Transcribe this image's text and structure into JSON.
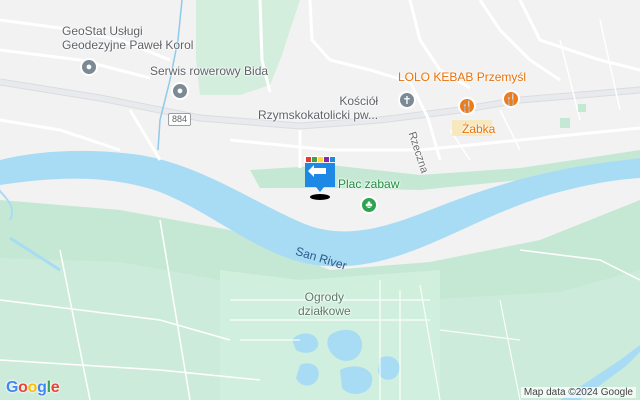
{
  "map": {
    "places": [
      {
        "id": "geostat",
        "text": "GeoStat Usługi\nGeodezyjne Paweł Korol",
        "kind": "business"
      },
      {
        "id": "bida",
        "text": "Serwis rowerowy Bida",
        "kind": "business"
      },
      {
        "id": "kosciol",
        "text": "Kościół\nRzymskokatolicki pw...",
        "kind": "church"
      },
      {
        "id": "lolo",
        "text": "LOLO KEBAB Przemyśl",
        "kind": "food"
      },
      {
        "id": "zabka",
        "text": "Żabka",
        "kind": "shop"
      },
      {
        "id": "plac",
        "text": "Plac zabaw",
        "kind": "park"
      },
      {
        "id": "ogrody",
        "text": "Ogrody\ndziałkowe",
        "kind": "area"
      }
    ],
    "road_labels": {
      "rzeczna": "Rzeczna",
      "route_shield": "884"
    },
    "water_label": "San River",
    "attribution": "Map data ©2024 Google",
    "logo": [
      "G",
      "o",
      "o",
      "g",
      "l",
      "e"
    ],
    "colors": {
      "water": "#a8dcf4",
      "park": "#c5e8d4",
      "land": "#f2f2f2",
      "road": "#ffffff",
      "highway": "#e8eaed",
      "accent_orange": "#e8710a",
      "poi_green": "#2da44e"
    },
    "marker": {
      "name": "custom-location-marker"
    }
  }
}
